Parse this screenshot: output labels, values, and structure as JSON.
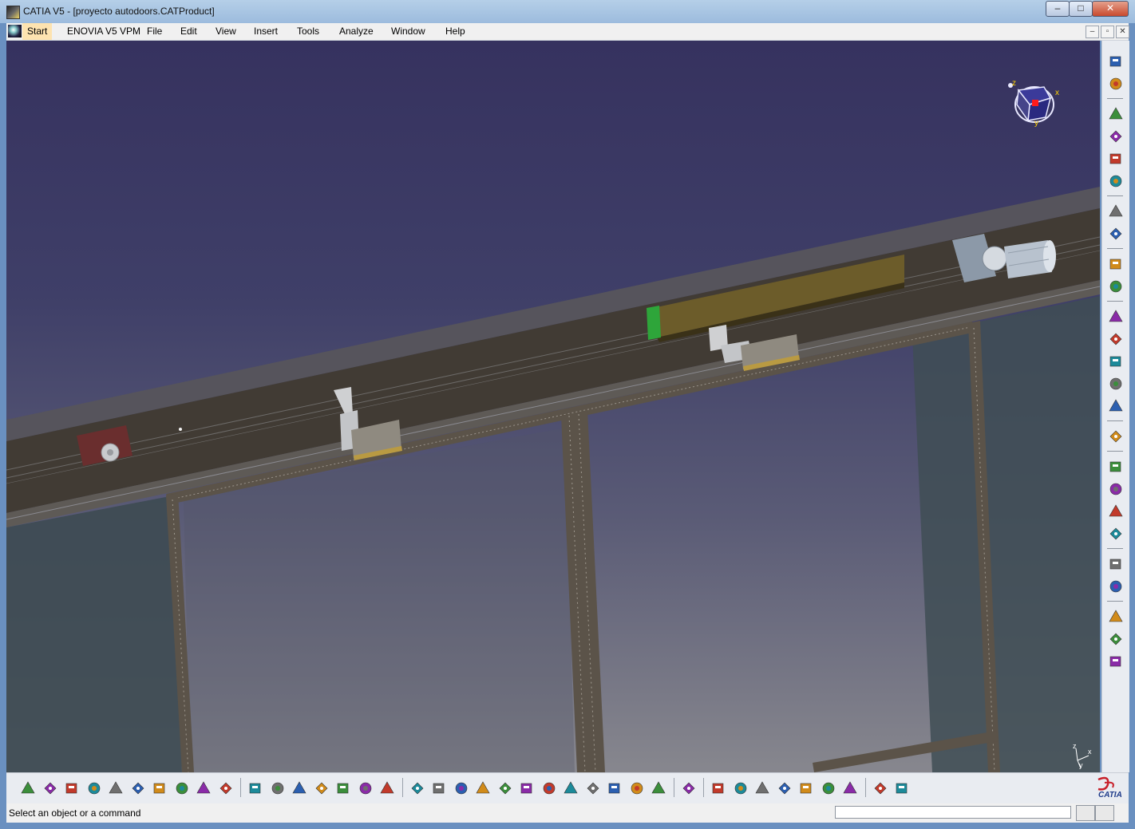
{
  "window": {
    "title": "CATIA V5 - [proyecto autodoors.CATProduct]",
    "controls": {
      "minimize": "–",
      "maximize": "□",
      "close": "✕"
    }
  },
  "menu": {
    "items": [
      "Start",
      "ENOVIA V5 VPM",
      "File",
      "Edit",
      "View",
      "Insert",
      "Tools",
      "Analyze",
      "Window",
      "Help"
    ]
  },
  "document_controls": {
    "minimize": "–",
    "restore": "▫",
    "close": "✕"
  },
  "compass": {
    "x": "x",
    "y": "y",
    "z": "z"
  },
  "axis_triad": {
    "x": "x",
    "y": "y",
    "z": "z"
  },
  "status_bar": {
    "prompt": "Select an object or a command",
    "command_value": ""
  },
  "branding": {
    "logo_text": "CATIA"
  },
  "colors": {
    "title_bar": "#b5cfe8",
    "viewport_top": "#36325f",
    "viewport_bottom": "#87878e",
    "rail": "#403a33",
    "frame": "#5b5349",
    "motor": "#b8c2ce",
    "battery": "#5a4c22"
  },
  "right_toolbar": {
    "icons": [
      "tree-icon",
      "catalog-icon",
      "catalog-structure-icon",
      "catalog-manage-icon",
      "catalog-save-icon",
      "select-arrow-icon",
      "fly-icon",
      "rotate-icon",
      "explode-icon",
      "constraint-icon",
      "anchor-icon",
      "measure-icon",
      "gear-icon",
      "manipulation-icon",
      "scene-icon",
      "clash-icon",
      "section-icon",
      "sheet-icon",
      "bom-icon",
      "weld-icon",
      "sphere-icon",
      "cube-color-icon",
      "spiral-icon",
      "hierarchy-icon",
      "home-icon"
    ]
  },
  "bottom_toolbar": {
    "icons": [
      "new-icon",
      "open-icon",
      "save-icon",
      "print-icon",
      "cut-icon",
      "copy-icon",
      "paste-icon",
      "undo-icon",
      "redo-icon",
      "whats-this-icon",
      "formula-icon",
      "comment-icon",
      "tag-icon",
      "table-icon",
      "tree-expand-icon",
      "lock-icon",
      "list-icon",
      "fly-mode-icon",
      "fit-all-icon",
      "pan-icon",
      "rotate-view-icon",
      "zoom-in-icon",
      "zoom-out-icon",
      "normal-view-icon",
      "multi-view-icon",
      "iso-view-icon",
      "shading-icon",
      "hide-show-icon",
      "swap-visible-icon",
      "capture-icon",
      "snap-icon",
      "previous-icon",
      "next-icon",
      "search-icon",
      "sections-icon",
      "render-icon",
      "highlight-icon",
      "arrange-icon",
      "publish-icon"
    ]
  }
}
